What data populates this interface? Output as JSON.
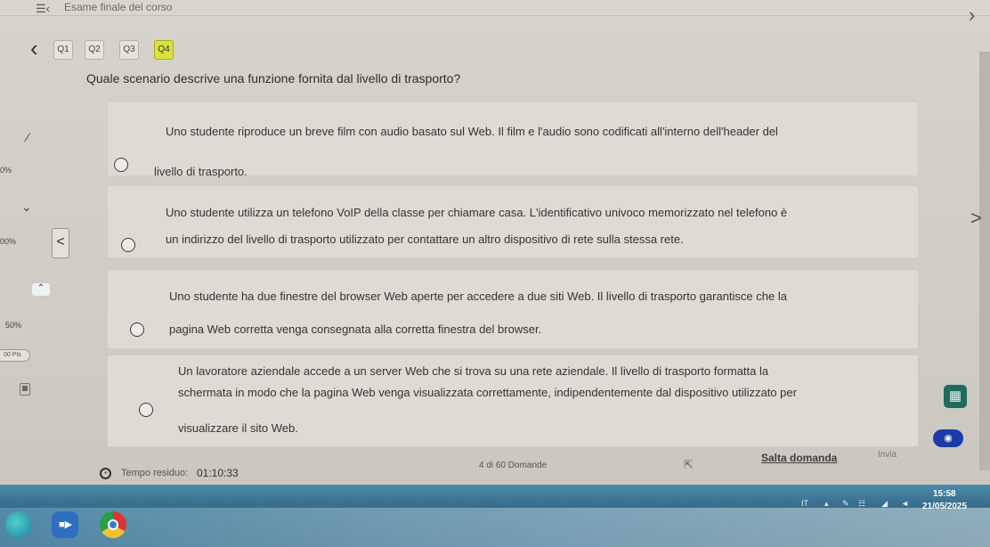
{
  "header": {
    "title": "Esame finale del corso",
    "menu_icon": "menu-back-icon",
    "next_icon": "chevron-right-icon"
  },
  "tabs": [
    {
      "label": "Q1",
      "active": false
    },
    {
      "label": "Q2",
      "active": false
    },
    {
      "label": "Q3",
      "active": false
    },
    {
      "label": "Q4",
      "active": true
    }
  ],
  "question": {
    "text": "Quale scenario descrive una funzione fornita dal livello di trasporto?"
  },
  "options": [
    {
      "line1": "Uno studente riproduce un breve film con audio basato sul Web. Il film e l'audio sono codificati all'interno dell'header del",
      "line2": "livello di trasporto."
    },
    {
      "line1": "Uno studente utilizza un telefono VoIP della classe per chiamare casa. L'identificativo univoco memorizzato nel telefono è",
      "line2": "un indirizzo del livello di trasporto utilizzato per contattare un altro dispositivo di rete sulla stessa rete."
    },
    {
      "line1": "Uno studente ha due finestre del browser Web aperte per accedere a due siti Web. Il livello di trasporto garantisce che la",
      "line2": "pagina Web corretta venga consegnata alla corretta finestra del browser."
    },
    {
      "line1": "Un lavoratore aziendale accede a un server Web che si trova su una rete aziendale. Il livello di trasporto formatta la",
      "line2": "schermata in modo che la pagina Web venga visualizzata correttamente, indipendentemente dal dispositivo utilizzato per",
      "line3": "visualizzare il sito Web."
    }
  ],
  "side": {
    "label_a": "0%",
    "label_b": "00%",
    "label_c": "50%",
    "pill": "00 Pts",
    "chev_prev": "<",
    "chev_next": ">"
  },
  "footer": {
    "timer_label": "Tempo residuo:",
    "timer_value": "01:10:33",
    "counter": "4 di 60 Domande",
    "skip_label": "Salta domanda",
    "submit_label": "Invia"
  },
  "taskbar": {
    "tray_lang": "IT",
    "clock_time": "15:58",
    "clock_date": "21/05/2025"
  },
  "colors": {
    "active_tab": "#d9e23a",
    "taskbar": "#3a6f8e",
    "calc_icon": "#1f6b5e",
    "badge": "#1c3aa8"
  }
}
